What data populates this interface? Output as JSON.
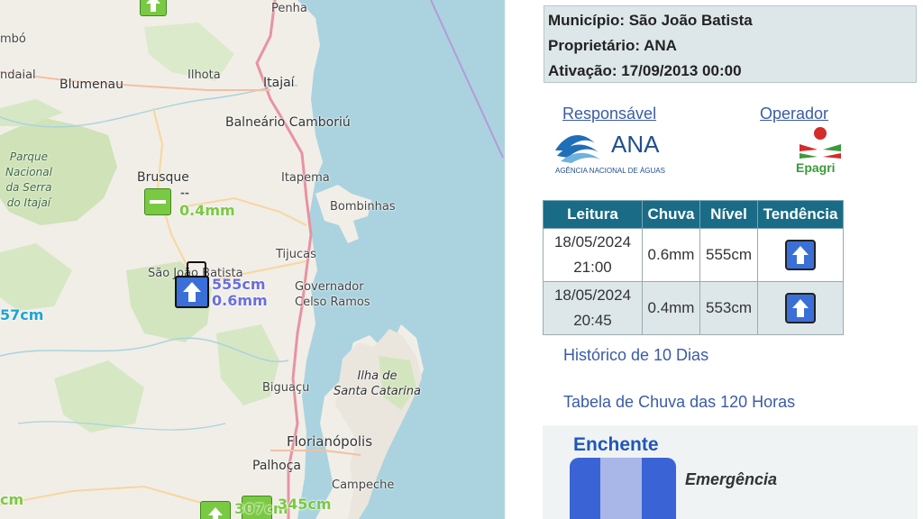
{
  "map": {
    "cities": {
      "penha": "Penha",
      "blumenau": "Blumenau",
      "ilhota": "Ilhota",
      "itajai": "Itajaí",
      "balneario": "Balneário Camboriú",
      "brusque": "Brusque",
      "itapema": "Itapema",
      "bombinhas": "Bombinhas",
      "tijucas": "Tijucas",
      "sao_joao": "São João Batista",
      "governador": "Governador\nCelso Ramos",
      "biguacu": "Biguaçu",
      "ilha": "Ilha de\nSanta Catarina",
      "florianopolis": "Florianópolis",
      "palhoca": "Palhoça",
      "campeche": "Campeche",
      "parque": "Parque\nNacional\nda Serra\ndo Itajaí",
      "edge1": "mbó",
      "edge2": "ndaial"
    },
    "markers": {
      "brusque_dash": "--",
      "brusque_rain": "0.4mm",
      "sj_level": "555cm",
      "sj_rain": "0.6mm",
      "left_level": "57cm",
      "bottom_left": "cm",
      "bottom1": "307cm",
      "bottom2": "345cm"
    }
  },
  "info": {
    "municipio": "Município: São João Batista",
    "proprietario": "Proprietário: ANA",
    "ativacao": "Ativação: 17/09/2013 00:00"
  },
  "links": {
    "responsavel": "Responsável",
    "operador": "Operador"
  },
  "logos": {
    "ana_text": "ANA",
    "ana_sub": "AGÊNCIA NACIONAL DE ÁGUAS",
    "epagri_text": "Epagri"
  },
  "table": {
    "headers": [
      "Leitura",
      "Chuva",
      "Nível",
      "Tendência"
    ],
    "rows": [
      {
        "date": "18/05/2024",
        "time": "21:00",
        "chuva": "0.6mm",
        "nivel": "555cm"
      },
      {
        "date": "18/05/2024",
        "time": "20:45",
        "chuva": "0.4mm",
        "nivel": "553cm"
      }
    ]
  },
  "history": {
    "ten_days": "Histórico de 10 Dias",
    "rain_table": "Tabela de Chuva das 120 Horas"
  },
  "flood": {
    "title": "Enchente",
    "level": "Emergência"
  },
  "colors": {
    "header_bg": "#1a6b86",
    "link": "#3b5ba8",
    "trend_up": "#3a6fd8",
    "marker_green": "#7ac943"
  }
}
